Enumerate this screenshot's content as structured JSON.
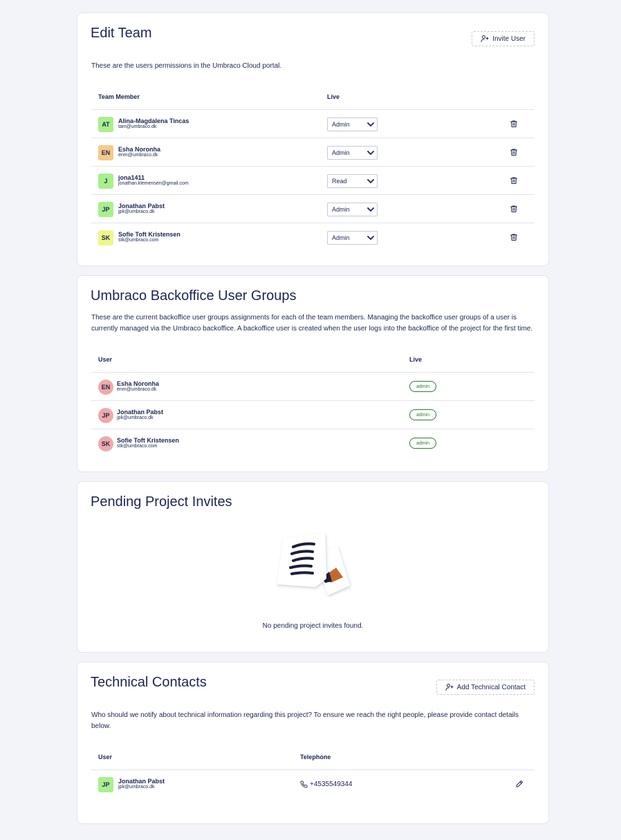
{
  "colors": {
    "page_bg": "#f3f4f9",
    "text": "#1b264f",
    "avatar_green": "#a8f08c",
    "avatar_orange": "#f5c98a",
    "avatar_yellow": "#eef78a",
    "avatar_pink": "#f0a9a9",
    "badge_green": "#2e7d32"
  },
  "edit_team": {
    "title": "Edit Team",
    "invite_label": "Invite User",
    "description": "These are the users permissions in the Umbraco Cloud portal.",
    "col_member": "Team Member",
    "col_live": "Live",
    "members": [
      {
        "initials": "AT",
        "name": "Alina-Magdalena Tincas",
        "email": "tam@umbraco.dk",
        "role": "Admin",
        "avatar_color": "#a8f08c"
      },
      {
        "initials": "EN",
        "name": "Esha Noronha",
        "email": "enm@umbraco.dk",
        "role": "Admin",
        "avatar_color": "#f5c98a"
      },
      {
        "initials": "J",
        "name": "jona1411",
        "email": "jonathan.klemensen@gmail.com",
        "role": "Read",
        "avatar_color": "#a8f08c"
      },
      {
        "initials": "JP",
        "name": "Jonathan Pabst",
        "email": "jpk@umbraco.dk",
        "role": "Admin",
        "avatar_color": "#a8f08c"
      },
      {
        "initials": "SK",
        "name": "Sofie Toft Kristensen",
        "email": "stk@umbraco.com",
        "role": "Admin",
        "avatar_color": "#eef78a"
      }
    ]
  },
  "backoffice": {
    "title": "Umbraco Backoffice User Groups",
    "description": "These are the current backoffice user groups assignments for each of the team members. Managing the backoffice user groups of a user is currently managed via the Umbraco backoffice. A backoffice user is created when the user logs into the backoffice of the project for the first time.",
    "col_user": "User",
    "col_live": "Live",
    "users": [
      {
        "initials": "EN",
        "name": "Esha Noronha",
        "email": "enm@umbraco.dk",
        "group": "admin"
      },
      {
        "initials": "JP",
        "name": "Jonathan Pabst",
        "email": "jpk@umbraco.dk",
        "group": "admin"
      },
      {
        "initials": "SK",
        "name": "Sofie Toft Kristensen",
        "email": "stk@umbraco.com",
        "group": "admin"
      }
    ]
  },
  "pending": {
    "title": "Pending Project Invites",
    "empty_text": "No pending project invites found."
  },
  "contacts": {
    "title": "Technical Contacts",
    "add_label": "Add Technical Contact",
    "description": "Who should we notify about technical information regarding this project? To ensure we reach the right people, please provide contact details below.",
    "col_user": "User",
    "col_phone": "Telephone",
    "items": [
      {
        "initials": "JP",
        "name": "Jonathan Pabst",
        "email": "jpk@umbraco.dk",
        "phone": "+4535549344",
        "avatar_color": "#a8f08c"
      }
    ]
  }
}
